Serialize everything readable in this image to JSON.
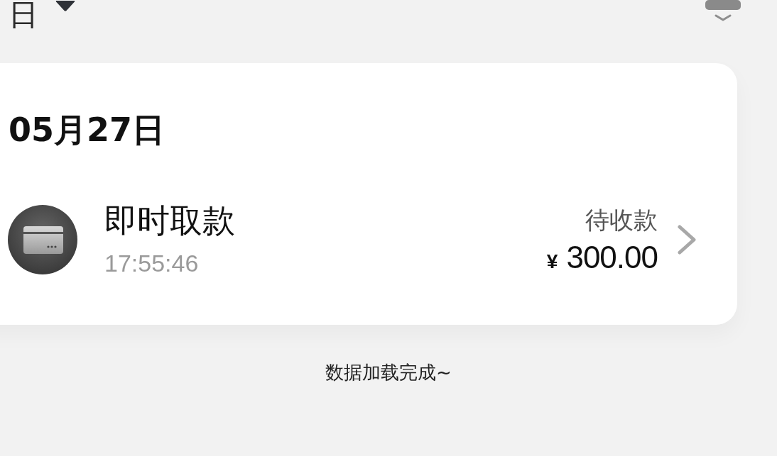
{
  "header": {
    "date_label": "日"
  },
  "card": {
    "date": "05月27日",
    "transactions": [
      {
        "title": "即时取款",
        "time": "17:55:46",
        "status": "待收款",
        "currency": "¥",
        "amount": "300.00"
      }
    ]
  },
  "footer": {
    "message": "数据加载完成~"
  }
}
